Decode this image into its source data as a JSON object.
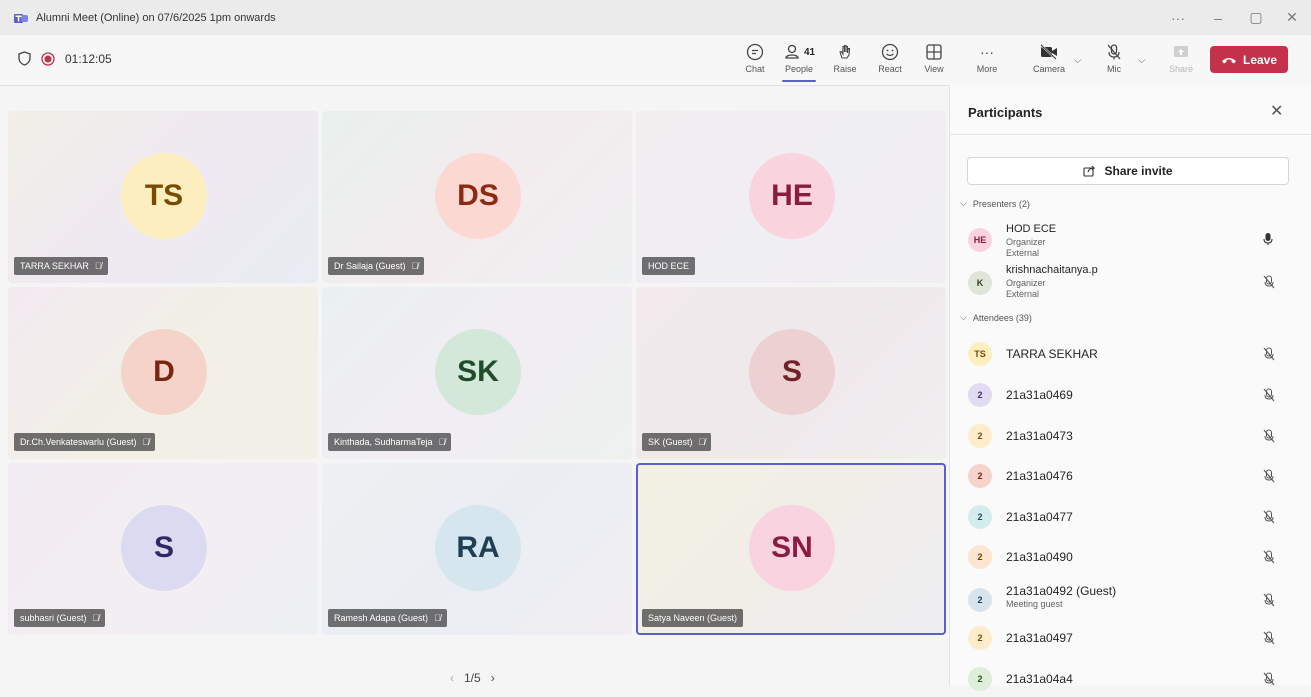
{
  "window": {
    "title": "Alumni Meet (Online) on 07/6/2025 1pm onwards",
    "controls": [
      "···",
      "–",
      "▢",
      "✕"
    ]
  },
  "toolbar": {
    "timer": "01:12:05",
    "buttons": {
      "chat": "Chat",
      "people": "People",
      "people_count": "41",
      "raise": "Raise",
      "react": "React",
      "view": "View",
      "more": "More",
      "camera": "Camera",
      "mic": "Mic",
      "share": "Share"
    },
    "leave": "Leave"
  },
  "tiles": [
    {
      "initials": "TS",
      "name": "TARRA SEKHAR",
      "muted": true,
      "avatar_bg": "#fdeec0",
      "avatar_fg": "#7a4a00"
    },
    {
      "initials": "DS",
      "name": "Dr Sailaja (Guest)",
      "muted": true,
      "avatar_bg": "#fbd9d2",
      "avatar_fg": "#8a2a14"
    },
    {
      "initials": "HE",
      "name": "HOD ECE",
      "muted": false,
      "avatar_bg": "#f9d3de",
      "avatar_fg": "#8a1c3c"
    },
    {
      "initials": "D",
      "name": "Dr.Ch.Venkateswarlu (Guest)",
      "muted": true,
      "avatar_bg": "#f5d3c8",
      "avatar_fg": "#7a2412"
    },
    {
      "initials": "SK",
      "name": "Kinthada, SudharmaTeja",
      "muted": true,
      "avatar_bg": "#d3e8d8",
      "avatar_fg": "#1f4d2c"
    },
    {
      "initials": "S",
      "name": "SK (Guest)",
      "muted": true,
      "avatar_bg": "#ecd0d2",
      "avatar_fg": "#6e2127"
    },
    {
      "initials": "S",
      "name": "subhasri (Guest)",
      "muted": true,
      "avatar_bg": "#dcdaf0",
      "avatar_fg": "#2f2a66"
    },
    {
      "initials": "RA",
      "name": "Ramesh Adapa (Guest)",
      "muted": true,
      "avatar_bg": "#d5e6ee",
      "avatar_fg": "#1f3f55"
    },
    {
      "initials": "SN",
      "name": "Satya Naveen (Guest)",
      "muted": false,
      "avatar_bg": "#f9d4e0",
      "avatar_fg": "#8a1c44"
    }
  ],
  "pager": {
    "label": "1/5"
  },
  "panel": {
    "title": "Participants",
    "share_invite": "Share invite",
    "presenters_header": "Presenters (2)",
    "attendees_header": "Attendees (39)",
    "presenters": [
      {
        "initials": "HE",
        "name": "HOD ECE",
        "role": "Organizer",
        "type": "External",
        "avatar_bg": "#f9d3de",
        "avatar_fg": "#8a1c3c",
        "mic": "on"
      },
      {
        "initials": "K",
        "name": "krishnachaitanya.p",
        "role": "Organizer",
        "type": "External",
        "avatar_bg": "#dfe6d9",
        "avatar_fg": "#2c4020",
        "mic": "off"
      }
    ],
    "attendees": [
      {
        "initials": "TS",
        "name": "TARRA SEKHAR",
        "sub": "",
        "avatar_bg": "#fdeec0",
        "avatar_fg": "#7a4a00"
      },
      {
        "initials": "2",
        "name": "21a31a0469",
        "sub": "",
        "avatar_bg": "#e2dcf2",
        "avatar_fg": "#3b2f7a"
      },
      {
        "initials": "2",
        "name": "21a31a0473",
        "sub": "",
        "avatar_bg": "#fdeccb",
        "avatar_fg": "#7a4a00"
      },
      {
        "initials": "2",
        "name": "21a31a0476",
        "sub": "",
        "avatar_bg": "#f5d3cc",
        "avatar_fg": "#7a2412"
      },
      {
        "initials": "2",
        "name": "21a31a0477",
        "sub": "",
        "avatar_bg": "#d5ecef",
        "avatar_fg": "#1f4f5a"
      },
      {
        "initials": "2",
        "name": "21a31a0490",
        "sub": "",
        "avatar_bg": "#fde5cf",
        "avatar_fg": "#7a4000"
      },
      {
        "initials": "2",
        "name": "21a31a0492 (Guest)",
        "sub": "Meeting guest",
        "avatar_bg": "#d7e4ee",
        "avatar_fg": "#1f3f55"
      },
      {
        "initials": "2",
        "name": "21a31a0497",
        "sub": "",
        "avatar_bg": "#fdeccb",
        "avatar_fg": "#7a4a00"
      },
      {
        "initials": "2",
        "name": "21a31a04a4",
        "sub": "",
        "avatar_bg": "#dfeed8",
        "avatar_fg": "#2c5020"
      }
    ]
  }
}
